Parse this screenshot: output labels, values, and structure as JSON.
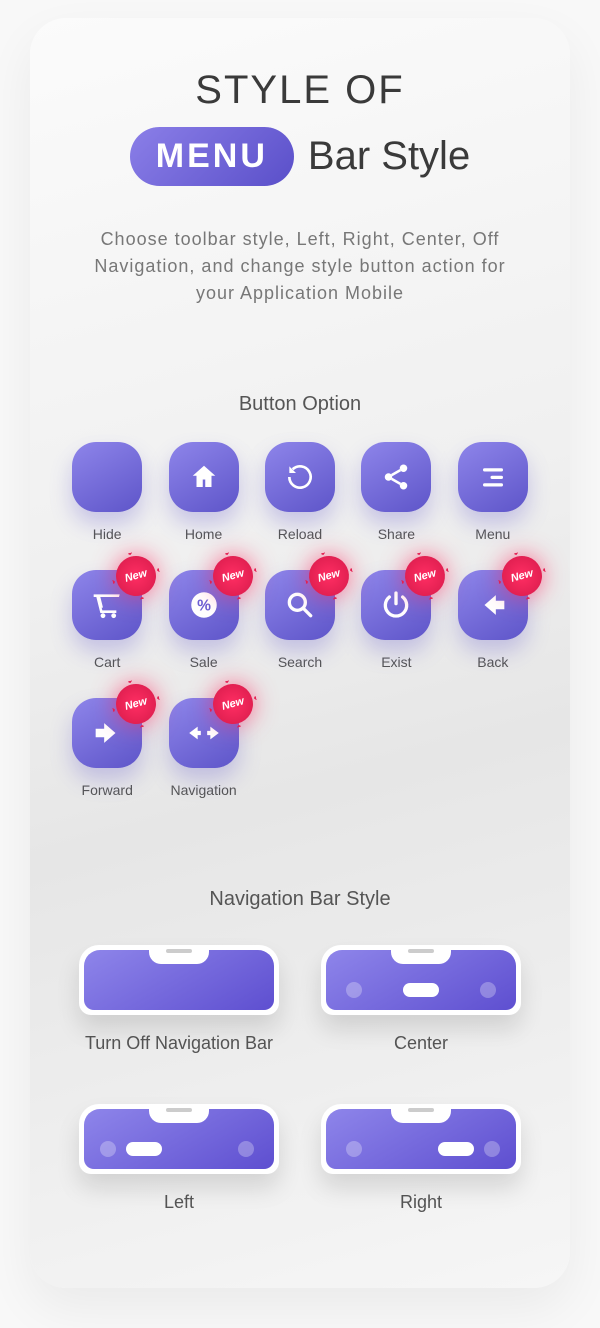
{
  "title": {
    "line1": "STYLE OF",
    "pill": "MENU",
    "line2_rest": "Bar Style"
  },
  "description": "Choose toolbar style, Left, Right, Center, Off Navigation, and change style button action for your Application Mobile",
  "sections": {
    "buttons_heading": "Button Option",
    "nav_heading": "Navigation Bar Style"
  },
  "badge_label": "New",
  "buttons": [
    {
      "id": "hide",
      "label": "Hide",
      "icon": "none",
      "new": false
    },
    {
      "id": "home",
      "label": "Home",
      "icon": "home",
      "new": false
    },
    {
      "id": "reload",
      "label": "Reload",
      "icon": "reload",
      "new": false
    },
    {
      "id": "share",
      "label": "Share",
      "icon": "share",
      "new": false
    },
    {
      "id": "menu",
      "label": "Menu",
      "icon": "menu",
      "new": false
    },
    {
      "id": "cart",
      "label": "Cart",
      "icon": "cart",
      "new": true
    },
    {
      "id": "sale",
      "label": "Sale",
      "icon": "sale",
      "new": true
    },
    {
      "id": "search",
      "label": "Search",
      "icon": "search",
      "new": true
    },
    {
      "id": "exist",
      "label": "Exist",
      "icon": "power",
      "new": true
    },
    {
      "id": "back",
      "label": "Back",
      "icon": "back",
      "new": true
    },
    {
      "id": "forward",
      "label": "Forward",
      "icon": "forward",
      "new": true
    },
    {
      "id": "navigation",
      "label": "Navigation",
      "icon": "navigation",
      "new": true
    }
  ],
  "nav_styles": [
    {
      "id": "off",
      "label": "Turn Off Navigation Bar",
      "layout": "off"
    },
    {
      "id": "center",
      "label": "Center",
      "layout": "center"
    },
    {
      "id": "left",
      "label": "Left",
      "layout": "left"
    },
    {
      "id": "right",
      "label": "Right",
      "layout": "right"
    }
  ]
}
